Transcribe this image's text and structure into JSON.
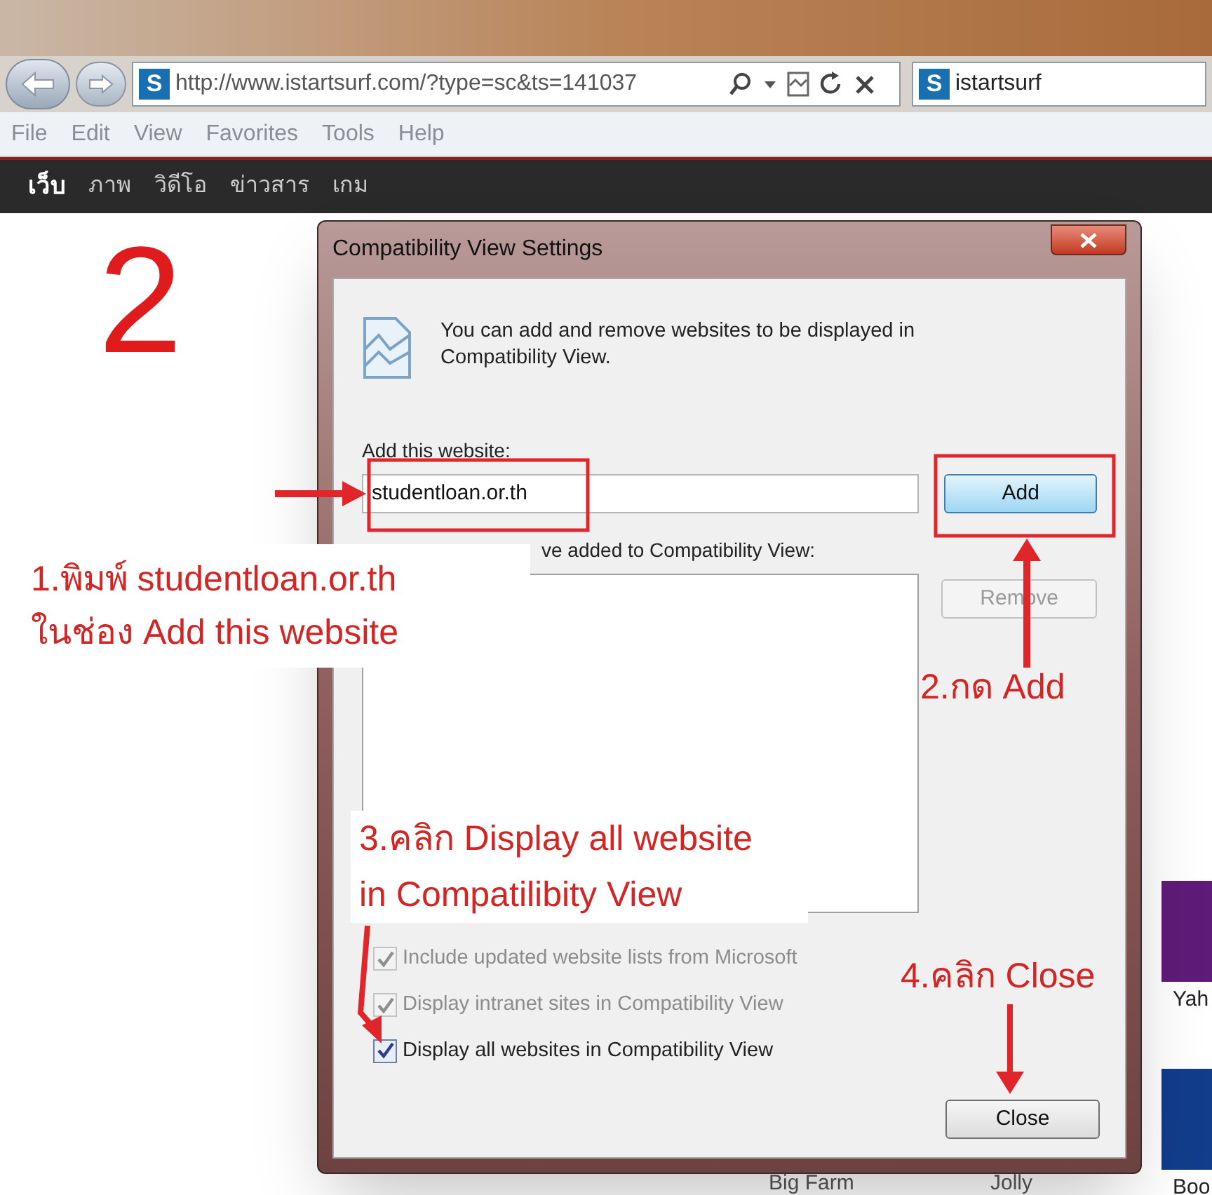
{
  "browser": {
    "address": "http://www.istartsurf.com/?type=sc&ts=141037",
    "tab_title": "istartsurf",
    "address_favicon": "S",
    "tab_favicon": "S",
    "menu": [
      "File",
      "Edit",
      "View",
      "Favorites",
      "Tools",
      "Help"
    ]
  },
  "page": {
    "nav": [
      {
        "label": "เว็บ",
        "selected": true
      },
      {
        "label": "ภาพ",
        "selected": false
      },
      {
        "label": "วิดีโอ",
        "selected": false
      },
      {
        "label": "ข่าวสาร",
        "selected": false
      },
      {
        "label": "เกม",
        "selected": false
      }
    ],
    "step_number": "2",
    "tiles": [
      {
        "label": "Yah",
        "color": "#5f1b78"
      },
      {
        "label": "Boo",
        "color": "#123d8a"
      }
    ],
    "bottom_labels": [
      "Big Farm",
      "Jolly"
    ]
  },
  "dialog": {
    "title": "Compatibility View Settings",
    "description": "You can add and remove websites to be displayed in Compatibility View.",
    "add_label": "Add this website:",
    "add_value": "studentloan.or.th",
    "add_button": "Add",
    "list_label": "ve added to Compatibility View:",
    "remove_button": {
      "label": "Remove",
      "disabled": true
    },
    "options": [
      {
        "label": "Include updated website lists from Microsoft",
        "checked": true,
        "disabled": true
      },
      {
        "label": "Display intranet sites in Compatibility View",
        "checked": true,
        "disabled": true
      },
      {
        "label": "Display all websites in Compatibility View",
        "checked": true,
        "disabled": false
      }
    ],
    "close_button": "Close"
  },
  "annotations": [
    {
      "kind": "boxed",
      "lines": [
        "1.พิมพ์ studentloan.or.th",
        "ในช่อง Add this website"
      ]
    },
    {
      "kind": "plain",
      "lines": [
        "2.กด Add"
      ]
    },
    {
      "kind": "boxed",
      "lines": [
        "3.คลิก Display all website",
        "in Compatilibity View"
      ]
    },
    {
      "kind": "plain",
      "lines": [
        "4.คลิก Close"
      ]
    }
  ]
}
